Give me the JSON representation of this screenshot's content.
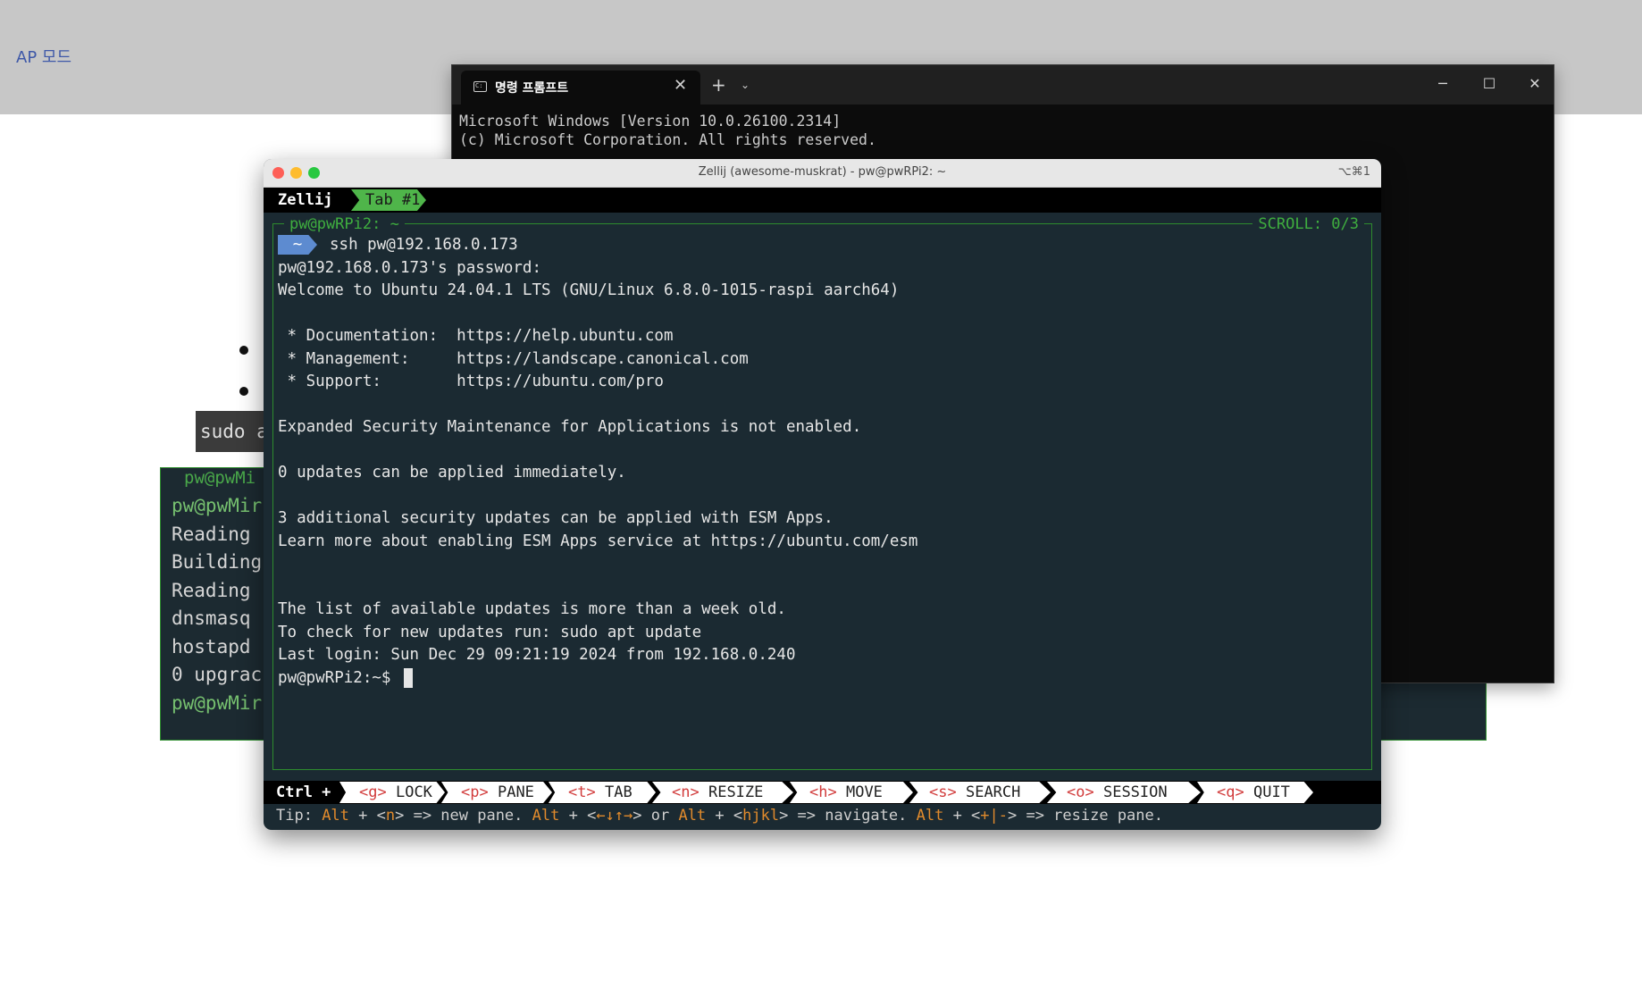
{
  "desktop": {
    "heading": "AP 모드"
  },
  "background_terminal": {
    "pane_title": "pw@pwMi",
    "sudo_snippet": "sudo a",
    "lines": [
      "pw@pwMir",
      "Reading ",
      "Building",
      "Reading ",
      "dnsmasq ",
      "hostapd ",
      "0 upgrac",
      "pw@pwMir"
    ]
  },
  "cmd_window": {
    "tab_label": "명령 프롬프트",
    "tab_icon": "terminal-icon",
    "close_tab": "✕",
    "new_tab": "+",
    "dropdown": "⌄",
    "minimize": "─",
    "maximize": "☐",
    "close": "✕",
    "lines": [
      "Microsoft Windows [Version 10.0.26100.2314]",
      "(c) Microsoft Corporation. All rights reserved."
    ]
  },
  "zellij_window": {
    "title": "Zellij (awesome-muskrat) - pw@pwRPi2: ~",
    "shortcut": "⌥⌘1",
    "app_label": "Zellij",
    "tab_label": "Tab #1",
    "pane_title": "pw@pwRPi2: ~",
    "scroll": "SCROLL:  0/3",
    "prompt_tag": "~",
    "command": "ssh pw@192.168.0.173",
    "output": [
      "pw@192.168.0.173's password:",
      "Welcome to Ubuntu 24.04.1 LTS (GNU/Linux 6.8.0-1015-raspi aarch64)",
      "",
      " * Documentation:  https://help.ubuntu.com",
      " * Management:     https://landscape.canonical.com",
      " * Support:        https://ubuntu.com/pro",
      "",
      "Expanded Security Maintenance for Applications is not enabled.",
      "",
      "0 updates can be applied immediately.",
      "",
      "3 additional security updates can be applied with ESM Apps.",
      "Learn more about enabling ESM Apps service at https://ubuntu.com/esm",
      "",
      "",
      "The list of available updates is more than a week old.",
      "To check for new updates run: sudo apt update",
      "Last login: Sun Dec 29 09:21:19 2024 from 192.168.0.240"
    ],
    "final_prompt": "pw@pwRPi2:~$",
    "status": {
      "ctrl": "Ctrl +",
      "buttons": [
        {
          "key": "<g>",
          "label": "LOCK"
        },
        {
          "key": "<p>",
          "label": "PANE"
        },
        {
          "key": "<t>",
          "label": "TAB"
        },
        {
          "key": "<n>",
          "label": "RESIZE"
        },
        {
          "key": "<h>",
          "label": "MOVE"
        },
        {
          "key": "<s>",
          "label": "SEARCH"
        },
        {
          "key": "<o>",
          "label": "SESSION"
        },
        {
          "key": "<q>",
          "label": "QUIT"
        }
      ]
    },
    "tip": {
      "prefix": "Tip: ",
      "alt": "Alt",
      "plus": " + <",
      "n": "n",
      "t1": "> => new pane. ",
      "arrows": "←↓↑→",
      "t2": "> or ",
      "hjkl": "hjkl",
      "t3": "> => navigate. ",
      "resize": "+|-",
      "t4": "> => resize pane."
    }
  },
  "colors": {
    "terminal_bg": "#1b2a32",
    "accent_green": "#4fb54a",
    "key_red": "#d23c3c",
    "alt_orange": "#e08a2c"
  }
}
